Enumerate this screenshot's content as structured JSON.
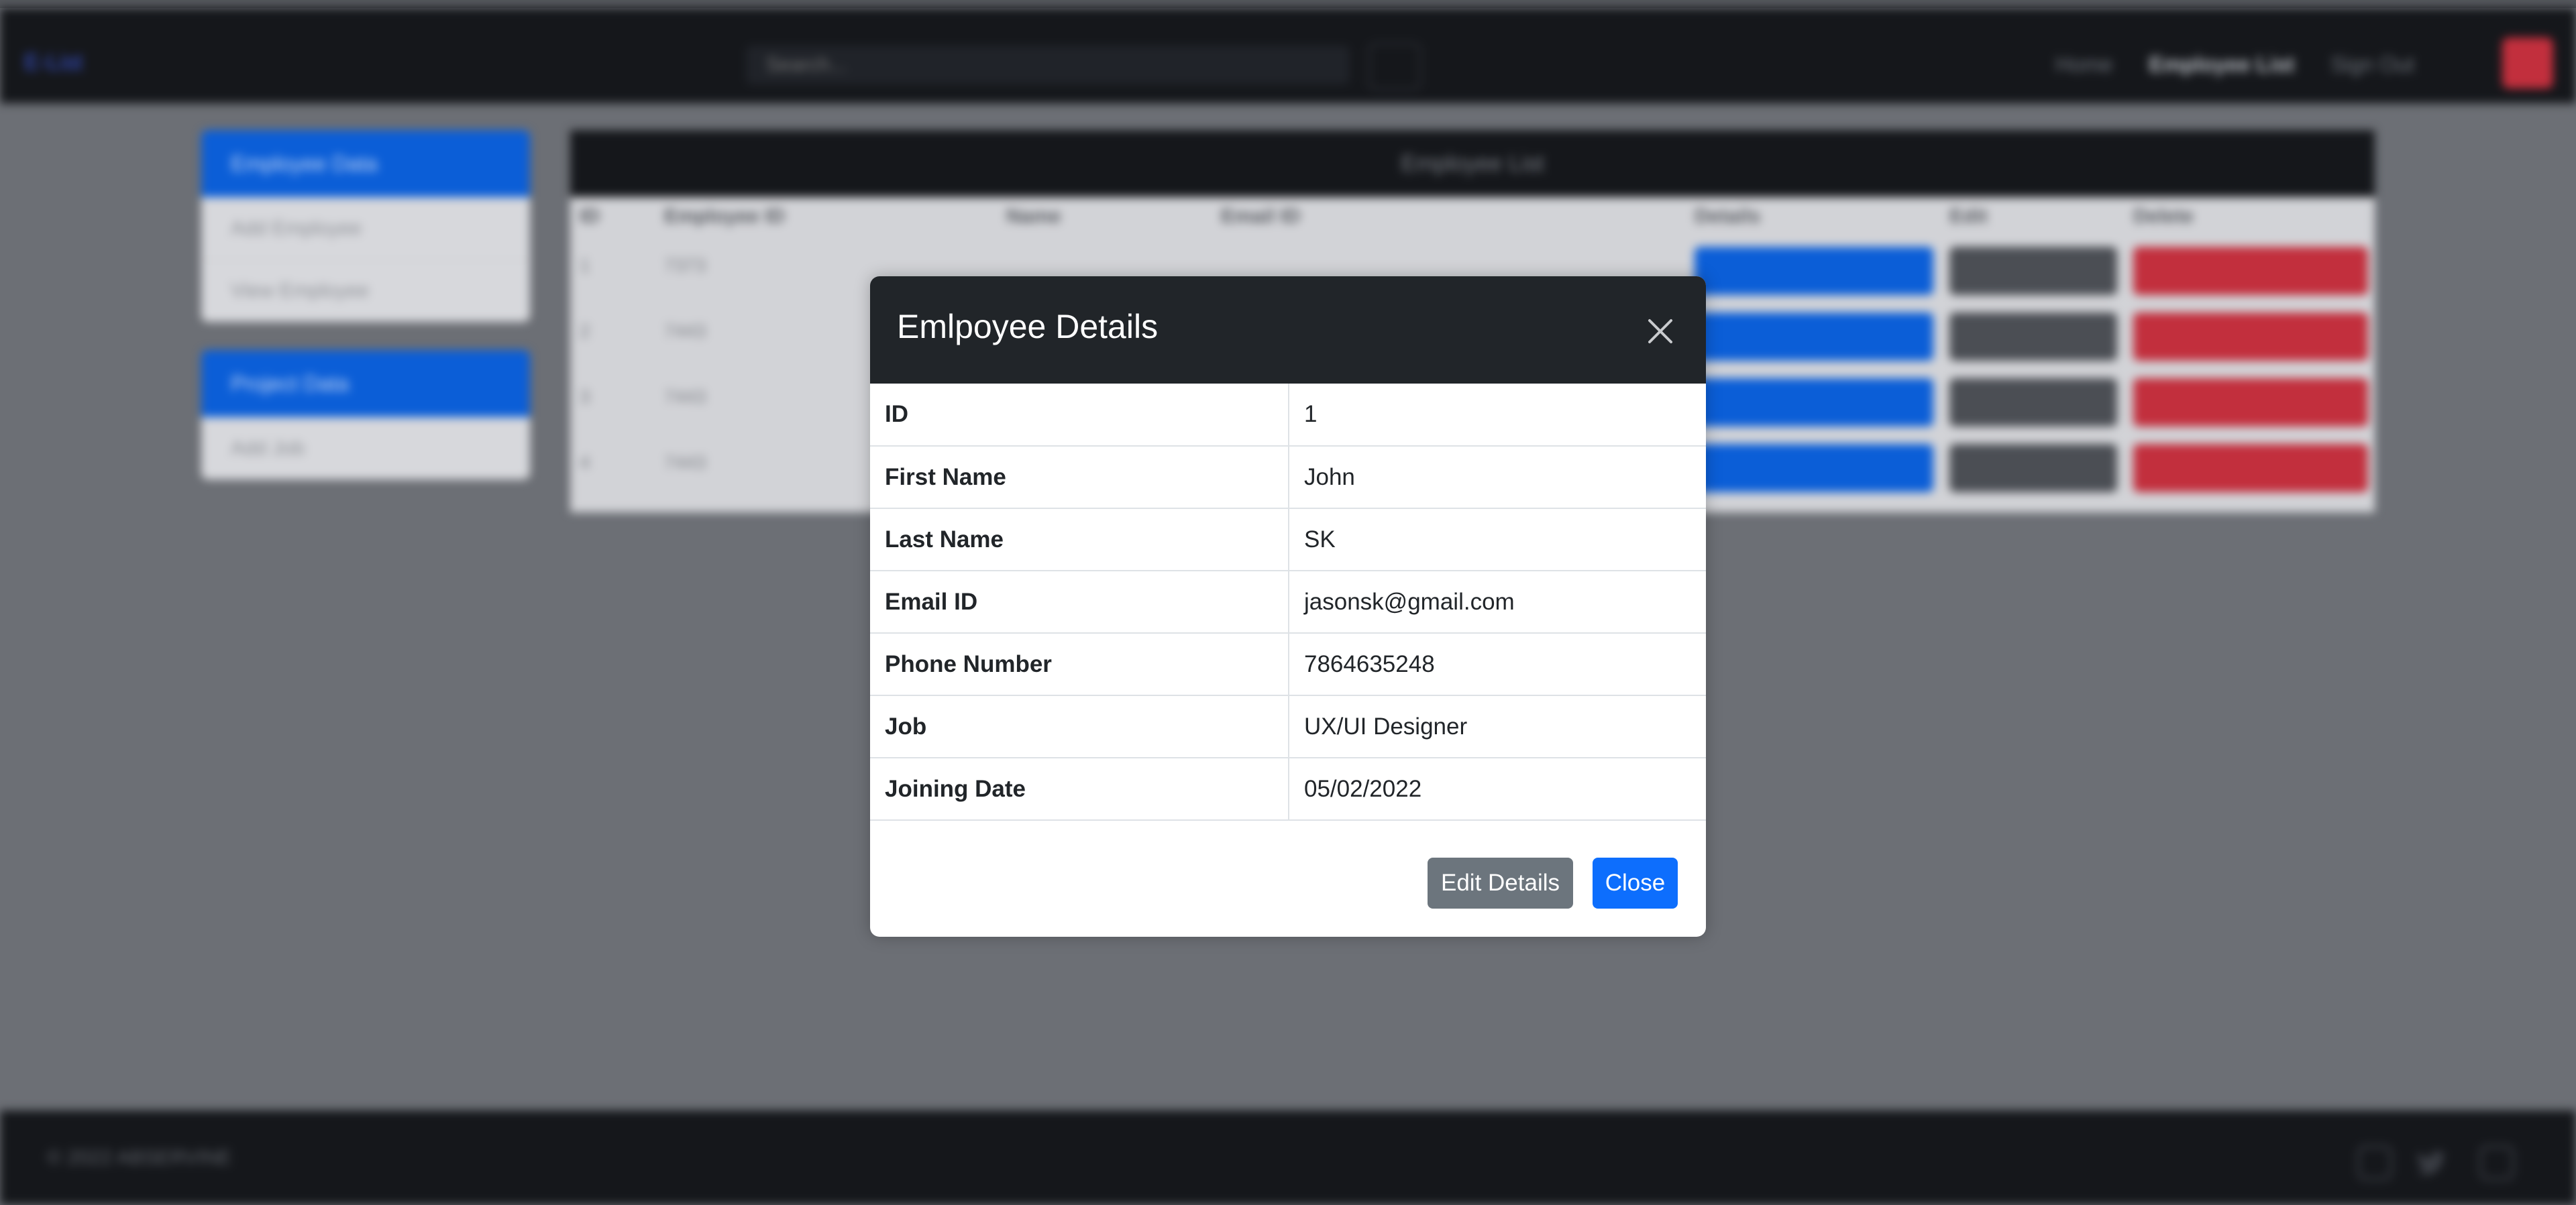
{
  "navbar": {
    "brand": "E-List",
    "search_placeholder": "Search...",
    "links": [
      "Home",
      "Employee List",
      "Sign Out"
    ]
  },
  "sidebar": {
    "employee_group": {
      "title": "Employee Data",
      "items": [
        "Add Employee",
        "View Employee"
      ]
    },
    "project_group": {
      "title": "Project Data",
      "items": [
        "Add Job"
      ]
    }
  },
  "employee_list": {
    "title": "Employee List",
    "columns": [
      "ID",
      "Employee ID",
      "Name",
      "Email ID",
      "Details",
      "Edit",
      "Delete"
    ],
    "rows": [
      {
        "id": "1",
        "employee_id": "7373"
      },
      {
        "id": "2",
        "employee_id": "7443"
      },
      {
        "id": "3",
        "employee_id": "7443"
      },
      {
        "id": "4",
        "employee_id": "7443"
      }
    ],
    "details_label": "Details",
    "edit_label": "Edit",
    "delete_label": "Delete"
  },
  "footer": {
    "copyright": "© 2022 ABSERVINE",
    "icons": [
      "github-icon",
      "twitter-icon",
      "instagram-icon"
    ]
  },
  "modal": {
    "title": "Emlpoyee Details",
    "fields": [
      {
        "label": "ID",
        "value": "1"
      },
      {
        "label": "First Name",
        "value": "John"
      },
      {
        "label": "Last Name",
        "value": "SK"
      },
      {
        "label": "Email ID",
        "value": "jasonsk@gmail.com"
      },
      {
        "label": "Phone Number",
        "value": "7864635248"
      },
      {
        "label": "Job",
        "value": "UX/UI Designer"
      },
      {
        "label": "Joining Date",
        "value": "05/02/2022"
      }
    ],
    "edit_button": "Edit Details",
    "close_button": "Close"
  },
  "colors": {
    "primary": "#0d6efd",
    "secondary": "#6c757d",
    "danger": "#c22f3d",
    "dark": "#212529"
  }
}
